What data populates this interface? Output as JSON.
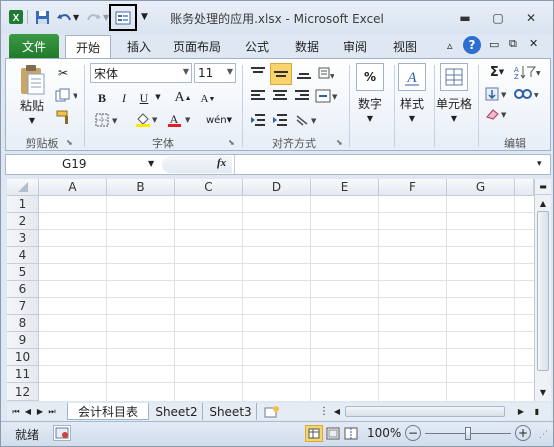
{
  "window": {
    "title": "账务处理的应用.xlsx  -  Microsoft Excel"
  },
  "qat": {
    "app_icon": "excel-icon",
    "save_icon": "save-icon",
    "undo_icon": "undo-icon",
    "redo_icon": "redo-icon",
    "form_icon": "form-icon",
    "customize_icon": "chevron-down-icon"
  },
  "tabs": [
    {
      "label": "文件"
    },
    {
      "label": "开始"
    },
    {
      "label": "插入"
    },
    {
      "label": "页面布局"
    },
    {
      "label": "公式"
    },
    {
      "label": "数据"
    },
    {
      "label": "审阅"
    },
    {
      "label": "视图"
    }
  ],
  "ribbon": {
    "clipboard": {
      "paste": "粘贴",
      "label": "剪贴板"
    },
    "font": {
      "name": "宋体",
      "size": "11",
      "bold": "B",
      "italic": "I",
      "underline": "U",
      "grow": "A",
      "shrink": "A",
      "font_color_letter": "A",
      "phonetic": "wén",
      "label": "字体"
    },
    "alignment": {
      "label": "对齐方式"
    },
    "number": {
      "percent": "%",
      "label": "数字"
    },
    "styles": {
      "label": "样式"
    },
    "cells": {
      "label": "单元格"
    },
    "editing": {
      "label": "编辑",
      "sigma": "Σ"
    }
  },
  "formula_bar": {
    "name_box": "G19",
    "fx": "fx",
    "value": ""
  },
  "grid": {
    "columns": [
      "A",
      "B",
      "C",
      "D",
      "E",
      "F",
      "G"
    ],
    "rows": [
      "1",
      "2",
      "3",
      "4",
      "5",
      "6",
      "7",
      "8",
      "9",
      "10",
      "11",
      "12"
    ]
  },
  "sheets": {
    "tabs": [
      "会计科目表",
      "Sheet2",
      "Sheet3"
    ],
    "active": "会计科目表"
  },
  "status": {
    "ready": "就绪",
    "zoom": "100%",
    "zoom_minus": "−",
    "zoom_plus": "+"
  },
  "colors": {
    "file_tab": "#217a2b",
    "ribbon_bg": "#e7eef7",
    "highlight": "#f9d36b",
    "font_color_bar": "#e02020",
    "fill_color_bar": "#ffe800"
  }
}
